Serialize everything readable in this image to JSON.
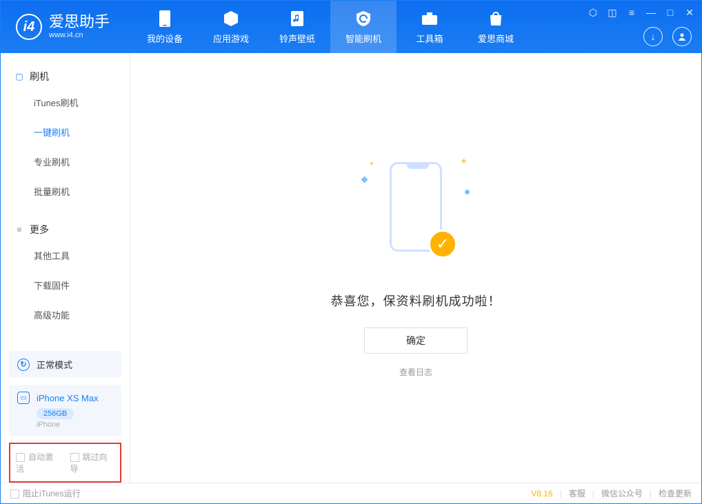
{
  "app": {
    "name": "爱思助手",
    "url": "www.i4.cn"
  },
  "tabs": [
    {
      "label": "我的设备"
    },
    {
      "label": "应用游戏"
    },
    {
      "label": "铃声壁纸"
    },
    {
      "label": "智能刷机"
    },
    {
      "label": "工具箱"
    },
    {
      "label": "爱思商城"
    }
  ],
  "sidebar": {
    "section1_title": "刷机",
    "section1_items": [
      "iTunes刷机",
      "一键刷机",
      "专业刷机",
      "批量刷机"
    ],
    "section2_title": "更多",
    "section2_items": [
      "其他工具",
      "下载固件",
      "高级功能"
    ]
  },
  "mode": {
    "label": "正常模式"
  },
  "device": {
    "name": "iPhone XS Max",
    "storage": "256GB",
    "type": "iPhone"
  },
  "checks": {
    "auto_activate": "自动激活",
    "skip_guide": "跳过向导"
  },
  "main": {
    "success_text": "恭喜您，保资料刷机成功啦！",
    "ok_button": "确定",
    "view_log": "查看日志"
  },
  "footer": {
    "block_itunes": "阻止iTunes运行",
    "version": "V8.16",
    "links": [
      "客服",
      "微信公众号",
      "检查更新"
    ]
  }
}
